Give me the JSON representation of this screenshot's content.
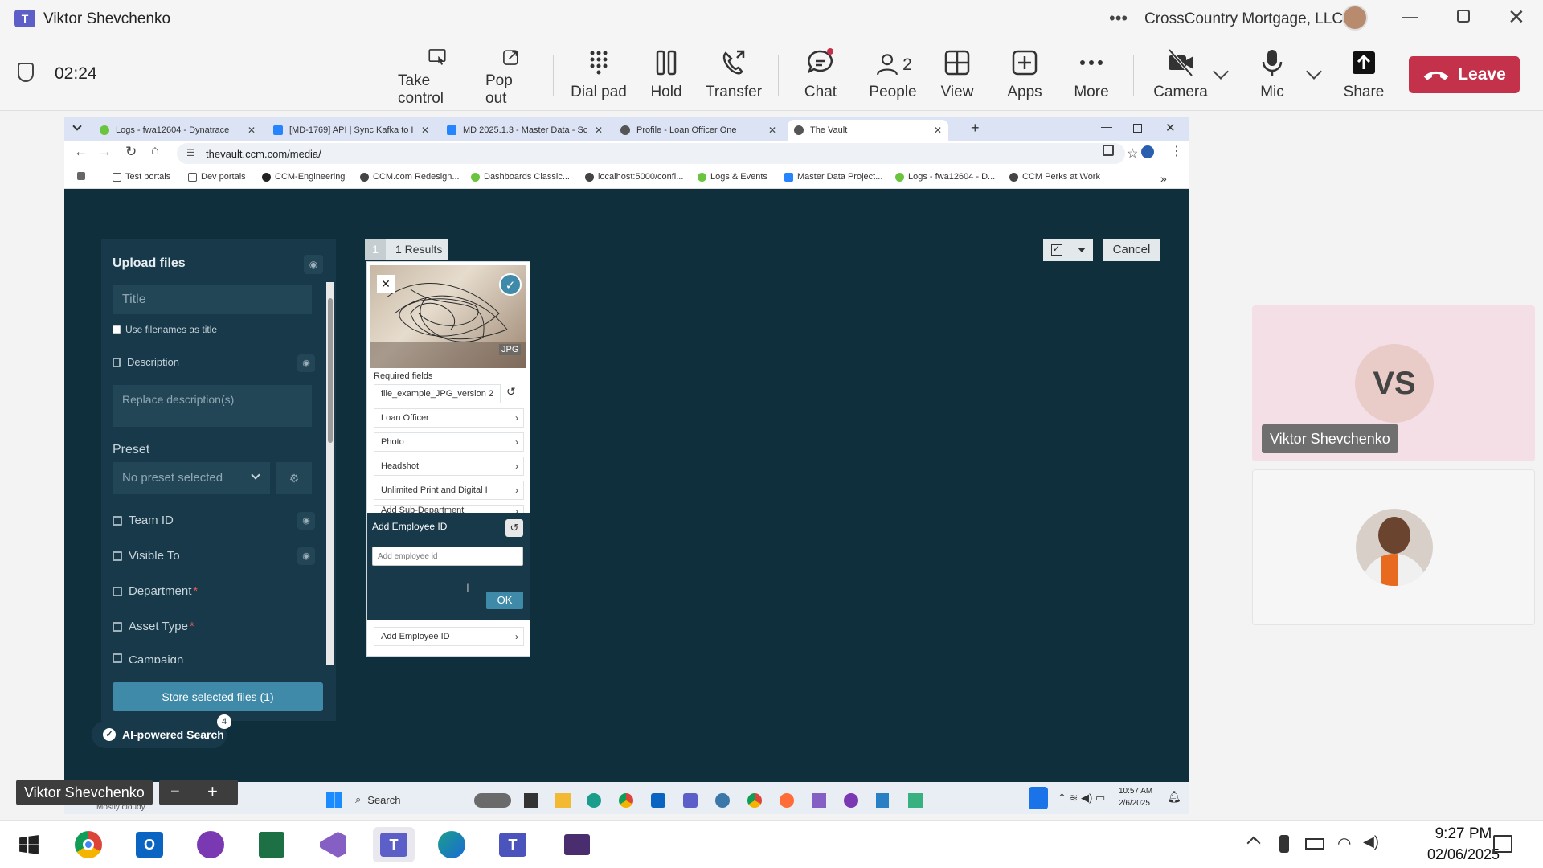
{
  "teams": {
    "window_title": "Viktor Shevchenko",
    "org": "CrossCountry Mortgage, LLC",
    "call_timer": "02:24",
    "toolbar": {
      "take_control": "Take control",
      "pop_out": "Pop out",
      "dial_pad": "Dial pad",
      "hold": "Hold",
      "transfer": "Transfer",
      "chat": "Chat",
      "people": "People",
      "people_count": "2",
      "view": "View",
      "apps": "Apps",
      "more": "More",
      "camera": "Camera",
      "mic": "Mic",
      "share": "Share",
      "leave": "Leave"
    },
    "participants": [
      {
        "initials": "VS",
        "name": "Viktor Shevchenko"
      }
    ],
    "presenter_label": "Viktor Shevchenko"
  },
  "browser": {
    "tabs": [
      {
        "label": "Logs - fwa12604 - Dynatrace"
      },
      {
        "label": "[MD-1769] API | Sync Kafka to I"
      },
      {
        "label": "MD 2025.1.3 - Master Data - Sc"
      },
      {
        "label": "Profile - Loan Officer One"
      },
      {
        "label": "The Vault"
      }
    ],
    "url": "thevault.ccm.com/media/",
    "bookmarks": [
      "Test portals",
      "Dev portals",
      "CCM-Engineering",
      "CCM.com Redesign...",
      "Dashboards Classic...",
      "localhost:5000/confi...",
      "Logs & Events",
      "Master Data Project...",
      "Logs - fwa12604 - D...",
      "CCM Perks at Work"
    ]
  },
  "vault": {
    "upload": {
      "title": "Upload files",
      "title_placeholder": "Title",
      "use_filenames": "Use filenames as title",
      "description_label": "Description",
      "description_placeholder": "Replace description(s)",
      "preset_label": "Preset",
      "preset_value": "No preset selected",
      "fields": [
        {
          "label": "Team ID",
          "required": ""
        },
        {
          "label": "Visible To",
          "required": ""
        },
        {
          "label": "Department",
          "required": "*"
        },
        {
          "label": "Asset Type",
          "required": "*"
        },
        {
          "label": "Campaign",
          "required": ""
        }
      ],
      "store_button": "Store selected files (1)",
      "ai_search": "AI-powered Search",
      "ai_badge": "4"
    },
    "results": {
      "page": "1",
      "count_label": "1 Results",
      "cancel": "Cancel"
    },
    "card": {
      "file_type": "JPG",
      "required_fields": "Required fields",
      "filename": "file_example_JPG_version 2",
      "rows": [
        "Loan Officer",
        "Photo",
        "Headshot",
        "Unlimited Print and Digital I",
        "Add Sub-Department"
      ],
      "popup_title": "Add Employee ID",
      "popup_placeholder": "Add employee id",
      "ok": "OK",
      "bottom_row": "Add Employee ID"
    }
  },
  "shared_taskbar": {
    "weather": "Mostly cloudy",
    "search": "Search",
    "time": "10:57 AM",
    "date": "2/6/2025"
  },
  "taskbar": {
    "time": "9:27 PM",
    "date": "02/06/2025"
  },
  "colors": {
    "leave": "#c4314b",
    "vault_bg": "#0f2f3c",
    "panel": "#18394a",
    "accent": "#3e8aa8"
  }
}
